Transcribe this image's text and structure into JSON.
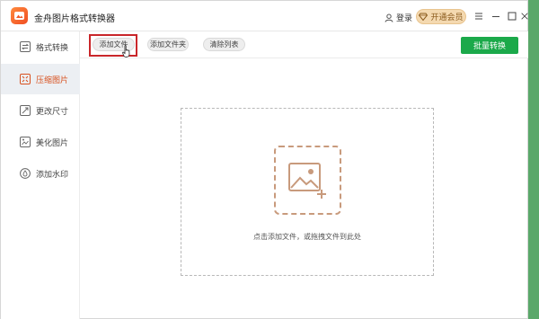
{
  "app": {
    "title": "金舟图片格式转换器"
  },
  "header": {
    "login_label": "登录",
    "vip_label": "开通会员"
  },
  "sidebar": {
    "items": [
      {
        "label": "格式转换",
        "icon": "convert-icon",
        "active": false
      },
      {
        "label": "压缩图片",
        "icon": "compress-icon",
        "active": true
      },
      {
        "label": "更改尺寸",
        "icon": "resize-icon",
        "active": false
      },
      {
        "label": "美化图片",
        "icon": "beautify-icon",
        "active": false
      },
      {
        "label": "添加水印",
        "icon": "watermark-icon",
        "active": false
      }
    ]
  },
  "toolbar": {
    "add_file_label": "添加文件",
    "add_folder_label": "添加文件夹",
    "clear_list_label": "清除列表",
    "batch_convert_label": "批量转换"
  },
  "dropzone": {
    "hint": "点击添加文件，或拖拽文件到此处"
  },
  "colors": {
    "accent": "#d8511f",
    "primary_button": "#1ba94a",
    "highlight_box": "#c9262a",
    "vip_bg": "#f4d9b0"
  }
}
